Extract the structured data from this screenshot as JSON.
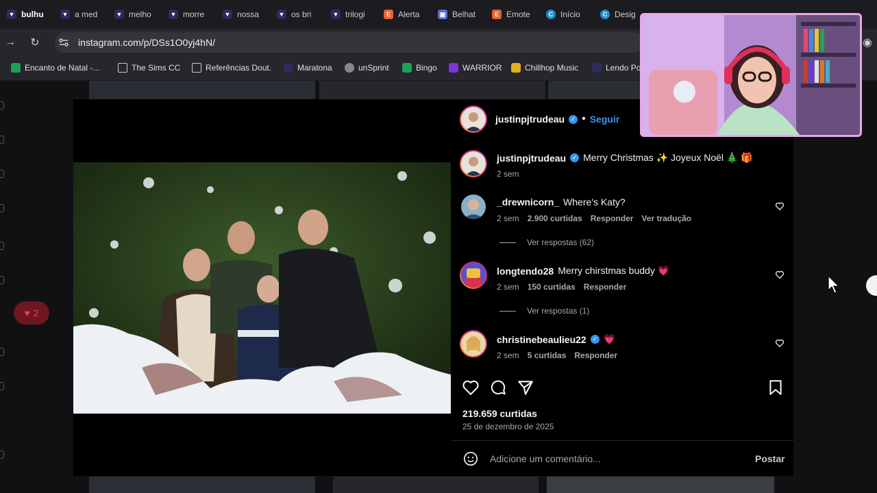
{
  "tabs": [
    {
      "label": "bulhu",
      "icon": "twitch-icon"
    },
    {
      "label": "a med",
      "icon": "twitch-icon"
    },
    {
      "label": "melho",
      "icon": "twitch-icon"
    },
    {
      "label": "morre",
      "icon": "twitch-icon"
    },
    {
      "label": "nossa",
      "icon": "twitch-icon"
    },
    {
      "label": "os bri",
      "icon": "twitch-icon"
    },
    {
      "label": "trilogi",
      "icon": "twitch-icon"
    },
    {
      "label": "Alerta",
      "icon": "etsy-icon"
    },
    {
      "label": "Belhat",
      "icon": "bookmark-app-icon"
    },
    {
      "label": "Emote",
      "icon": "etsy-icon"
    },
    {
      "label": "Início",
      "icon": "canva-icon"
    },
    {
      "label": "Desig",
      "icon": "canva-icon"
    }
  ],
  "address_bar": {
    "url": "instagram.com/p/DSs1O0yj4hN/"
  },
  "bookmarks": [
    {
      "label": "Encanto de Natal -...",
      "icon": "green-app-icon"
    },
    {
      "label": "The Sims CC",
      "icon": "folder-icon"
    },
    {
      "label": "Referências Dout.",
      "icon": "folder-icon"
    },
    {
      "label": "Maratona",
      "icon": "twitch-icon"
    },
    {
      "label": "unSprint",
      "icon": "globe-icon"
    },
    {
      "label": "Bingo",
      "icon": "green-app-icon"
    },
    {
      "label": "WARRIOR",
      "icon": "purple-app-icon"
    },
    {
      "label": "Chillhop Music",
      "icon": "yellow-app-icon"
    },
    {
      "label": "Lendo Po",
      "icon": "twitch-icon"
    }
  ],
  "notification": {
    "count": "2"
  },
  "post": {
    "author": "justinpjtrudeau",
    "follow_label": "Seguir",
    "separator": "•",
    "caption": {
      "user": "justinpjtrudeau",
      "text": "Merry Christmas ✨ Joyeux Noël 🎄 🎁",
      "time": "2 sem"
    },
    "comments": [
      {
        "user": "_drewnicorn_",
        "text": "Where's Katy?",
        "time": "2 sem",
        "likes": "2.900 curtidas",
        "reply_label": "Responder",
        "translate_label": "Ver tradução",
        "view_replies": "Ver respostas (62)"
      },
      {
        "user": "longtendo28",
        "text": "Merry chirstmas buddy 💗",
        "time": "2 sem",
        "likes": "150 curtidas",
        "reply_label": "Responder",
        "view_replies": "Ver respostas (1)"
      },
      {
        "user": "christinebeaulieu22",
        "text": "💗",
        "time": "2 sem",
        "likes": "5 curtidas",
        "reply_label": "Responder"
      }
    ],
    "likes": "219.659 curtidas",
    "date": "25 de dezembro de 2025",
    "comment_placeholder": "Adicione um comentário...",
    "post_button": "Postar"
  },
  "colors": {
    "accent_blue": "#3797f0",
    "verified_blue": "#3797f0",
    "notification_bg": "#6e1622"
  }
}
